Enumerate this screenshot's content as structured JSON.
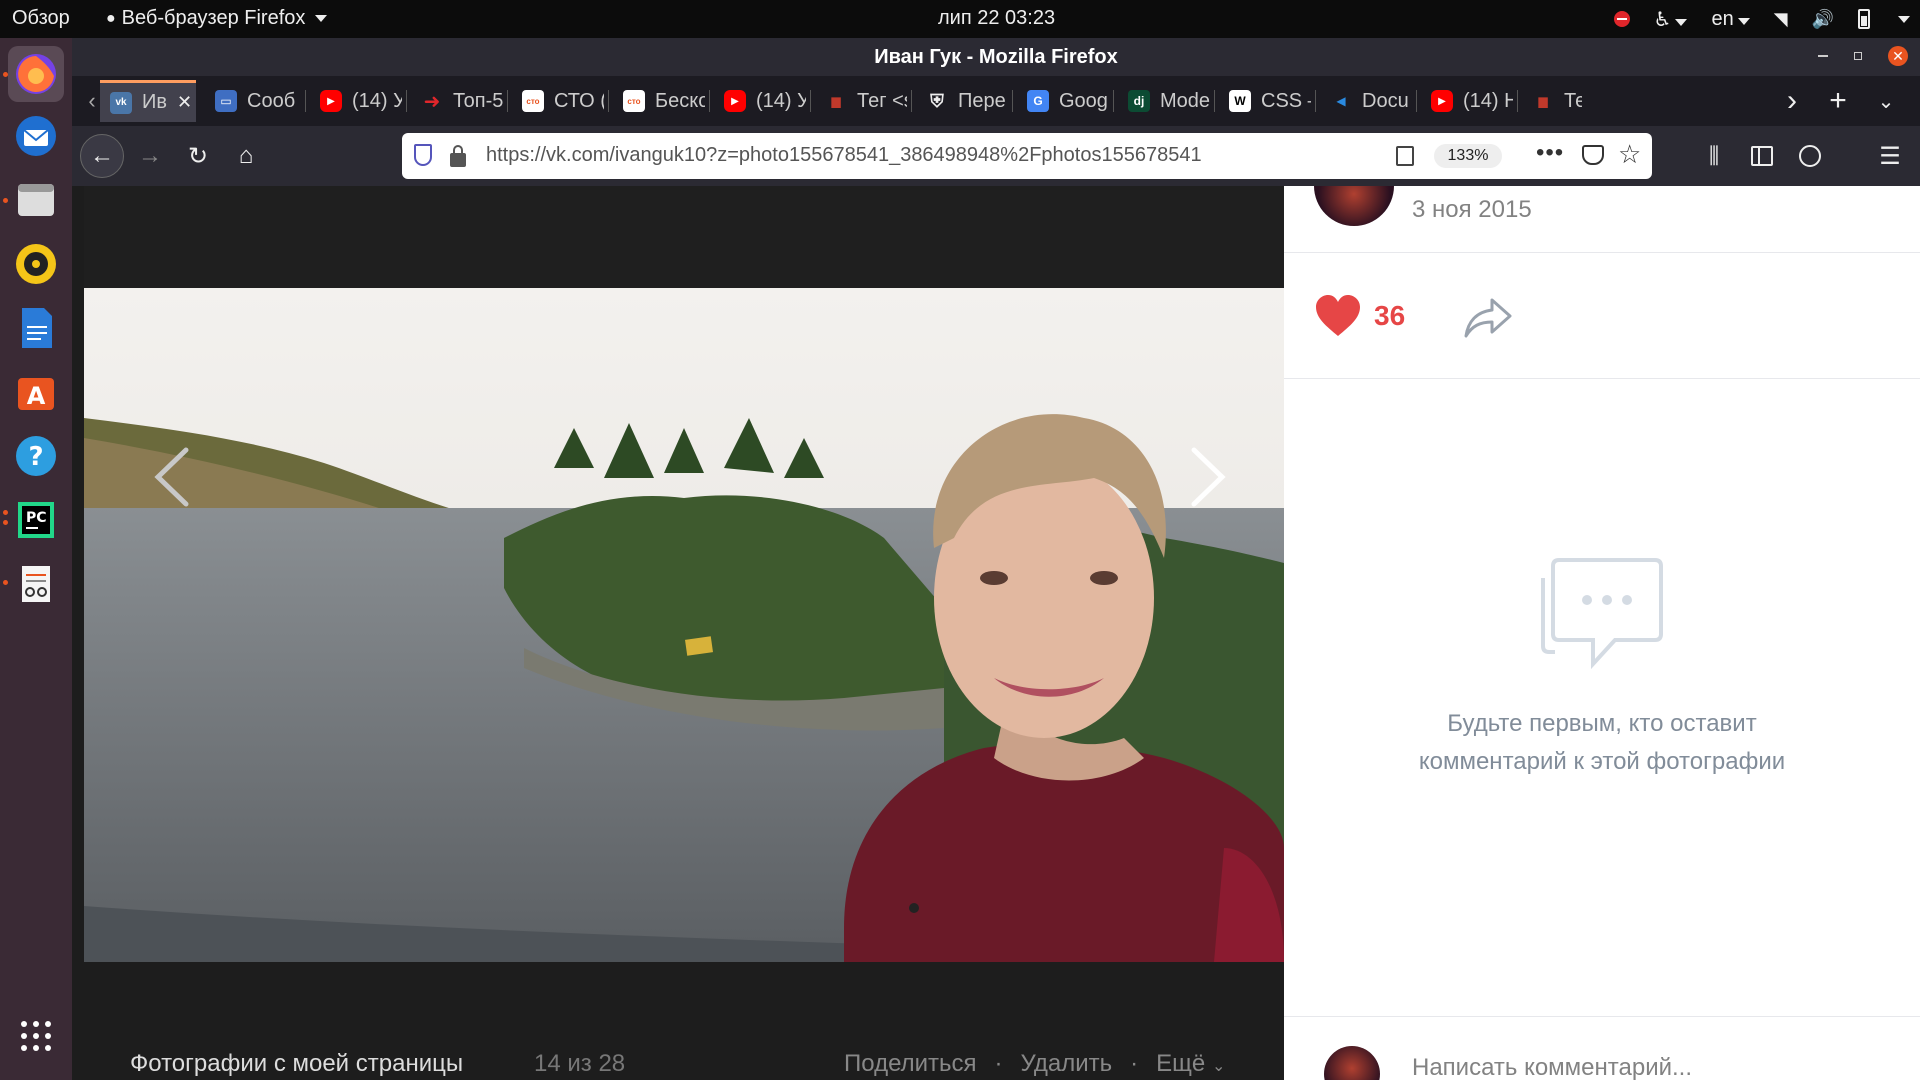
{
  "topbar": {
    "overview": "Обзор",
    "app_name": "Веб-браузер Firefox",
    "clock": "лип 22  03:23",
    "lang": "en"
  },
  "dock": {
    "items": [
      "firefox-icon",
      "thunderbird-icon",
      "files-icon",
      "rhythmbox-icon",
      "writer-icon",
      "software-icon",
      "help-icon",
      "pycharm-icon",
      "notes-icon",
      "apps-grid-icon"
    ]
  },
  "window": {
    "title": "Иван Гук - Mozilla Firefox"
  },
  "tabs": [
    {
      "label": "Ив",
      "favicon": "vk",
      "color": "#4a76a8",
      "active": true
    },
    {
      "label": "Сооб",
      "favicon": "chat",
      "color": "#3f6ec2"
    },
    {
      "label": "(14) У",
      "favicon": "youtube",
      "color": "#ff0000"
    },
    {
      "label": "Топ-5",
      "favicon": "arrow",
      "color": "#e0262b"
    },
    {
      "label": "СТО (",
      "favicon": "cto",
      "color": "#ffffff"
    },
    {
      "label": "Беско",
      "favicon": "cto",
      "color": "#ffffff"
    },
    {
      "label": "(14) У",
      "favicon": "youtube",
      "color": "#ff0000"
    },
    {
      "label": "Тег <s",
      "favicon": "html",
      "color": "#c0392b"
    },
    {
      "label": "Пере",
      "favicon": "shield",
      "color": "#555555"
    },
    {
      "label": "Googl",
      "favicon": "gtranslate",
      "color": "#4285f4"
    },
    {
      "label": "Mode",
      "favicon": "django",
      "color": "#0c4b33"
    },
    {
      "label": "CSS –",
      "favicon": "wikipedia",
      "color": "#ffffff"
    },
    {
      "label": "Docu",
      "favicon": "vscode",
      "color": "#007acc"
    },
    {
      "label": "(14) Н",
      "favicon": "youtube",
      "color": "#ff0000"
    },
    {
      "label": "Тег",
      "favicon": "html",
      "color": "#c0392b"
    }
  ],
  "navbar": {
    "url": "https://vk.com/ivanguk10?z=photo155678541_386498948%2Fphotos155678541",
    "zoom": "133%"
  },
  "photo_viewer": {
    "album": "Фотографии с моей страницы",
    "counter": "14 из 28",
    "actions": [
      "Поделиться",
      "·",
      "Удалить",
      "·",
      "Ещё"
    ]
  },
  "side": {
    "date": "3 ноя 2015",
    "likes": "36",
    "empty_comments": [
      "Будьте первым, кто оставит",
      "комментарий к этой фотографии"
    ],
    "comment_placeholder": "Написать комментарий..."
  },
  "colors": {
    "like": "#e64646",
    "vk_grey": "#818c99",
    "active_tab_line": "#ff9d60",
    "dock_bg": "#3a2a35"
  }
}
